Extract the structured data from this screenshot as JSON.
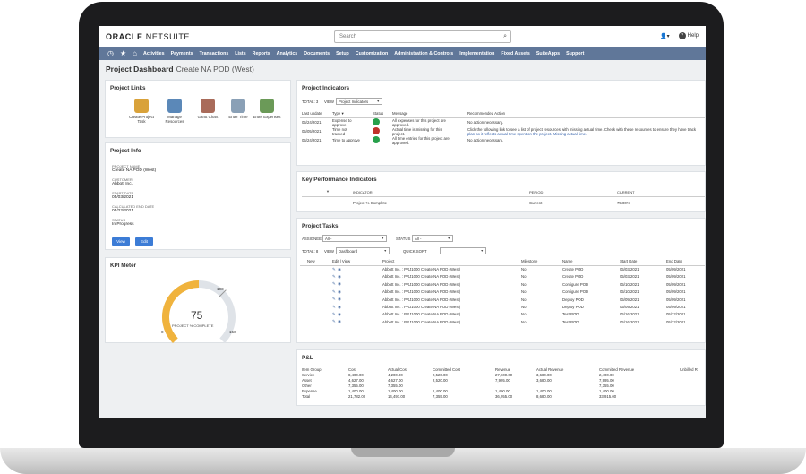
{
  "app": {
    "logo_a": "ORACLE",
    "logo_b": "NETSUITE",
    "search_placeholder": "Search",
    "help": "Help"
  },
  "nav": [
    "Activities",
    "Payments",
    "Transactions",
    "Lists",
    "Reports",
    "Analytics",
    "Documents",
    "Setup",
    "Customization",
    "Administration & Controls",
    "Implementation",
    "Fixed Assets",
    "SuiteApps",
    "Support"
  ],
  "page": {
    "title": "Project Dashboard",
    "subtitle": "Create NA POD (West)"
  },
  "links": {
    "title": "Project Links",
    "items": [
      {
        "label": "Create Project Task",
        "icon": "task-icon",
        "color": "#d9a23a"
      },
      {
        "label": "Manage Resources",
        "icon": "resources-icon",
        "color": "#5b88b8"
      },
      {
        "label": "Gantt Chart",
        "icon": "gantt-icon",
        "color": "#a96b5a"
      },
      {
        "label": "Enter Time",
        "icon": "time-icon",
        "color": "#8aa0b6"
      },
      {
        "label": "Enter Expenses",
        "icon": "expenses-icon",
        "color": "#6b9a58"
      }
    ]
  },
  "info": {
    "title": "Project Info",
    "f": [
      {
        "l": "PROJECT NAME",
        "v": "Create NA POD (West)"
      },
      {
        "l": "CUSTOMER",
        "v": "Abbott Inc."
      },
      {
        "l": "START DATE",
        "v": "05/03/2021"
      },
      {
        "l": "CALCULATED END DATE",
        "v": "05/22/2021"
      },
      {
        "l": "STATUS",
        "v": "In Progress"
      }
    ],
    "view": "View",
    "edit": "Edit"
  },
  "kpi": {
    "title": "KPI Meter",
    "value": "75",
    "label": "PROJECT % COMPLETE",
    "min": "0",
    "max": "100",
    "max2": "150",
    "fraction": 0.75
  },
  "ind": {
    "title": "Project Indicators",
    "total": "TOTAL: 3",
    "view": "VIEW",
    "sel": "Project Indicators",
    "cols": [
      "Last update",
      "Type ▾",
      "Status",
      "Message",
      "Recommended Action"
    ],
    "rows": [
      {
        "d": "05/24/2021",
        "t1": "Expense to",
        "t2": "approve",
        "c": "#27a04b",
        "m1": "All expenses for this project are",
        "m2": "approved.",
        "a1": "No action necessary.",
        "a2": ""
      },
      {
        "d": "05/05/2021",
        "t1": "Time not",
        "t2": "tracked",
        "c": "#c0322b",
        "m1": "Actual time is missing for this",
        "m2": "project.",
        "a1": "Click the following link to see a list of project resources with missing actual time. Check with these resources to ensure they have track",
        "a2": "plan so it reflects actual time spent on the project. Missing actual time."
      },
      {
        "d": "05/24/2021",
        "t1": "Time to approve",
        "t2": "",
        "c": "#27a04b",
        "m1": "All time entries for this project are",
        "m2": "approved.",
        "a1": "No action necessary.",
        "a2": ""
      }
    ]
  },
  "kpis": {
    "title": "Key Performance Indicators",
    "cols": [
      "INDICATOR",
      "PERIOD",
      "CURRENT"
    ],
    "row": [
      "Project % Complete",
      "Current",
      "75.00%"
    ]
  },
  "tasks": {
    "title": "Project Tasks",
    "assignee": "ASSIGNEE",
    "all": "All -",
    "status": "STATUS",
    "total": "TOTAL: 8",
    "view": "VIEW",
    "dash": "Dashboard",
    "qs": "QUICK SORT",
    "cols": [
      "New",
      "Edit | View",
      "Project",
      "Milestone",
      "Name",
      "Start Date",
      "End Date"
    ],
    "rows": [
      [
        "Abbott Inc. : PRJ1000 Create NA POD (West)",
        "No",
        "Create POD",
        "05/03/2021",
        "05/09/2021"
      ],
      [
        "Abbott Inc. : PRJ1000 Create NA POD (West)",
        "No",
        "Create POD",
        "05/03/2021",
        "05/09/2021"
      ],
      [
        "Abbott Inc. : PRJ1000 Create NA POD (West)",
        "No",
        "Configure POD",
        "05/10/2021",
        "05/09/2021"
      ],
      [
        "Abbott Inc. : PRJ1000 Create NA POD (West)",
        "No",
        "Configure POD",
        "05/10/2021",
        "05/09/2021"
      ],
      [
        "Abbott Inc. : PRJ1000 Create NA POD (West)",
        "No",
        "Deploy POD",
        "05/09/2021",
        "05/09/2021"
      ],
      [
        "Abbott Inc. : PRJ1000 Create NA POD (West)",
        "No",
        "Deploy POD",
        "05/09/2021",
        "05/09/2021"
      ],
      [
        "Abbott Inc. : PRJ1000 Create NA POD (West)",
        "No",
        "Test POD",
        "05/16/2021",
        "05/22/2021"
      ],
      [
        "Abbott Inc. : PRJ1000 Create NA POD (West)",
        "No",
        "Test POD",
        "05/16/2021",
        "05/22/2021"
      ]
    ]
  },
  "pl": {
    "title": "P&L",
    "cols": [
      "Item Group",
      "Cost",
      "Actual Cost",
      "Committed Cost",
      "Revenue",
      "Actual Revenue",
      "Committed Revenue",
      "Unbilled R"
    ],
    "rows": [
      [
        "Service",
        "8,400.00",
        "4,200.00",
        "2,520.00",
        "27,600.00",
        "3,680.00",
        "2,400.00"
      ],
      [
        "Asset",
        "4,627.00",
        "4,627.00",
        "2,520.00",
        "7,995.00",
        "3,680.00",
        "7,995.00"
      ],
      [
        "Other",
        "7,355.00",
        "7,355.00",
        "",
        "",
        "",
        "7,355.00"
      ],
      [
        "Expense",
        "1,400.00",
        "1,400.00",
        "1,400.00",
        "1,400.00",
        "1,400.00",
        "1,400.00"
      ],
      [
        "Total",
        "21,782.00",
        "14,497.00",
        "7,355.00",
        "36,955.00",
        "8,680.00",
        "33,915.00"
      ]
    ]
  }
}
